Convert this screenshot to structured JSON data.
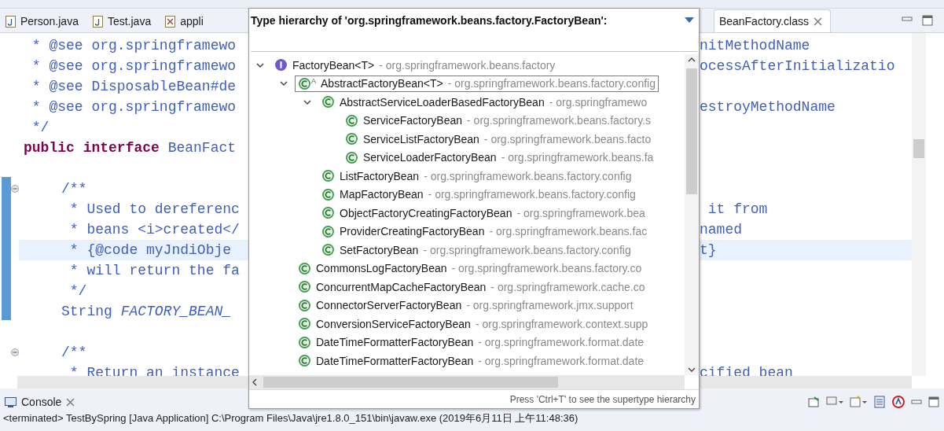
{
  "editor_tabs": [
    {
      "label": "Person.java",
      "kind": "java",
      "selected": false,
      "closable": false
    },
    {
      "label": "Test.java",
      "kind": "java",
      "selected": false,
      "closable": false
    },
    {
      "label": "appli",
      "kind": "xml",
      "selected": false,
      "closable": false
    },
    {
      "label": "BeanFactory.class",
      "kind": "class",
      "selected": true,
      "closable": true
    }
  ],
  "code_lines": [
    {
      "left": " * @see org.springframewo",
      "right": "nitMethodName",
      "nested": false,
      "highlighted": false,
      "fold": false
    },
    {
      "left": " * @see org.springframewo",
      "right": "ocessAfterInitializatio",
      "nested": false,
      "highlighted": false,
      "fold": false
    },
    {
      "left": " * @see DisposableBean#de",
      "nested": false,
      "highlighted": false,
      "fold": false
    },
    {
      "left": " * @see org.springframewo",
      "right": "estroyMethodName",
      "nested": false,
      "highlighted": false,
      "fold": false
    },
    {
      "left": " */",
      "nested": false,
      "highlighted": false,
      "fold": false
    },
    {
      "left": "**public** **interface** BeanFact",
      "nested": false,
      "highlighted": false,
      "fold": false
    },
    {
      "highlighted": false,
      "fold": false
    },
    {
      "left": "/**",
      "nested": true,
      "highlighted": false,
      "fold": true
    },
    {
      "left": " * Used to dereferenc",
      "right": " it from",
      "nested": true,
      "highlighted": false,
      "fold": false
    },
    {
      "left": " * beans <i>created</",
      "right": "named",
      "nested": true,
      "highlighted": false,
      "fold": false
    },
    {
      "left": " * {@code myJndiObje",
      "right": "t}",
      "nested": true,
      "highlighted": true,
      "fold": false
    },
    {
      "left": " * will return the fa",
      "nested": true,
      "highlighted": false,
      "fold": false
    },
    {
      "left": " */",
      "nested": true,
      "highlighted": false,
      "fold": false
    },
    {
      "left": "String *FACTORY_BEAN_*",
      "nested": true,
      "highlighted": false,
      "fold": false
    },
    {
      "highlighted": false,
      "fold": false
    },
    {
      "left": "/**",
      "nested": true,
      "highlighted": false,
      "fold": true
    },
    {
      "left": " * Return an instance",
      "right": "cified bean",
      "nested": true,
      "highlighted": false,
      "fold": false
    }
  ],
  "hierarchy_popup": {
    "title": "Type hierarchy of 'org.springframework.beans.factory.FactoryBean':",
    "tree": [
      {
        "name": "FactoryBean<T>",
        "package": "- org.springframework.beans.factory",
        "kind": "interface",
        "expanded": true,
        "selected": false,
        "children": [
          {
            "name": "AbstractFactoryBean<T>",
            "package": "- org.springframework.beans.factory.config",
            "kind": "class",
            "modifier": "A",
            "expanded": true,
            "selected": true,
            "children": [
              {
                "name": "AbstractServiceLoaderBasedFactoryBean",
                "package": "- org.springframewo",
                "kind": "class",
                "expanded": true,
                "selected": false,
                "children": [
                  {
                    "name": "ServiceFactoryBean",
                    "package": "- org.springframework.beans.factory.s",
                    "kind": "class",
                    "selected": false
                  },
                  {
                    "name": "ServiceListFactoryBean",
                    "package": "- org.springframework.beans.facto",
                    "kind": "class",
                    "selected": false
                  },
                  {
                    "name": "ServiceLoaderFactoryBean",
                    "package": "- org.springframework.beans.fa",
                    "kind": "class",
                    "selected": false
                  }
                ]
              },
              {
                "name": "ListFactoryBean",
                "package": "- org.springframework.beans.factory.config",
                "kind": "class",
                "selected": false
              },
              {
                "name": "MapFactoryBean",
                "package": "- org.springframework.beans.factory.config",
                "kind": "class",
                "selected": false
              },
              {
                "name": "ObjectFactoryCreatingFactoryBean",
                "package": "- org.springframework.bea",
                "kind": "class",
                "selected": false
              },
              {
                "name": "ProviderCreatingFactoryBean",
                "package": "- org.springframework.beans.fac",
                "kind": "class",
                "selected": false
              },
              {
                "name": "SetFactoryBean",
                "package": "- org.springframework.beans.factory.config",
                "kind": "class",
                "selected": false
              }
            ]
          },
          {
            "name": "CommonsLogFactoryBean",
            "package": "- org.springframework.beans.factory.co",
            "kind": "class",
            "selected": false
          },
          {
            "name": "ConcurrentMapCacheFactoryBean",
            "package": "- org.springframework.cache.co",
            "kind": "class",
            "selected": false
          },
          {
            "name": "ConnectorServerFactoryBean",
            "package": "- org.springframework.jmx.support",
            "kind": "class",
            "selected": false
          },
          {
            "name": "ConversionServiceFactoryBean",
            "package": "- org.springframework.context.supp",
            "kind": "class",
            "selected": false
          },
          {
            "name": "DateTimeFormatterFactoryBean",
            "package": "- org.springframework.format.date",
            "kind": "class",
            "selected": false
          },
          {
            "name": "DateTimeFormatterFactoryBean",
            "package": "- org.springframework.format.date",
            "kind": "class",
            "selected": false
          }
        ]
      }
    ],
    "status": "Press 'Ctrl+T' to see the supertype hierarchy"
  },
  "console": {
    "tab": "Console",
    "output": "<terminated> TestBySpring [Java Application] C:\\Program Files\\Java\\jre1.8.0_151\\bin\\javaw.exe (2019年6月11日 上午11:48:36)"
  }
}
